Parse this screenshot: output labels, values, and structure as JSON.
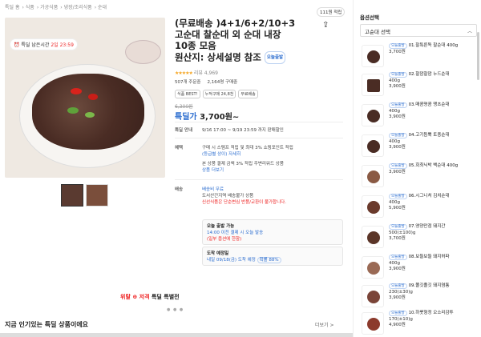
{
  "breadcrumb": [
    "특딜 홈",
    "식품",
    "가공식품",
    "냉장/조리식품",
    "순대"
  ],
  "timer": {
    "label": "특딜 남은시간",
    "value": "2일 23:59"
  },
  "coupon_tag": "111원 적립",
  "title": {
    "line1": "(무료배송 )4+1/6+2/10+3",
    "line2": "고순대 찰순대 외 순대 내장",
    "line3": "10종 모음",
    "line4": "원산지: 상세설명 참조",
    "brand_badge": "오늘출발"
  },
  "rating": {
    "stars": "★★★★★",
    "text": "리뷰 4,969"
  },
  "stats": {
    "likes": "507개 주문중",
    "buyers": "2,164명 구매중",
    "extra": ""
  },
  "tags": [
    "식품 BEST!",
    "누적구매 24,8천",
    "무료배송"
  ],
  "price": {
    "original": "6,300원",
    "label": "특딜가",
    "value": "3,700원~"
  },
  "info": {
    "deal_label": "특딜 안내",
    "deal_value": "9/16 17:00 ~ 9/19 23:59 까지 판매할인",
    "benefit_label": "혜택",
    "benefit_line1": "구매 시 스템프 적립 및 최대 3% 쇼핑포인트 적립",
    "benefit_line2": "(등급별 상이) 자세히",
    "benefit_line3": "본 상품 결제 금액 3% 적립 주변리워드 상품",
    "benefit_line4": "상품 더보기",
    "ship_label": "배송",
    "ship_line1": "배송비 무료",
    "ship_line2": "도서산간지역 배송불가 상품",
    "ship_line3": "신선식품은 단순변심 반품/교환이 불가합니다."
  },
  "ship_box1": {
    "title": "오늘 출발 가능",
    "line1": "14:00 이전 결제 시 오늘 발송",
    "line2": "(일부 옵션에 한함)"
  },
  "ship_box2": {
    "title": "도착 예정일",
    "line1": "내일 09/18(금) 도착 예정",
    "badge": "확률 88%"
  },
  "banner": {
    "left": "위탈",
    "mid": "저격",
    "right": "특딜 특별전"
  },
  "dots": "● ● ●",
  "popular": {
    "title": "지금 인기있는 특딜 상품이에요",
    "more": "더보기 >"
  },
  "side": {
    "title": "옵션선택",
    "select_label": "고순대 선택",
    "options": [
      {
        "badge": "오늘출발",
        "name": "01.찰특른독 찰순대 400g",
        "price": "3,700원"
      },
      {
        "badge": "오늘출발",
        "name": "02.찰깜찰깜 누드순대",
        "sub": "400g",
        "price": "3,900원"
      },
      {
        "badge": "오늘출발",
        "name": "03.매콤명콤 맹초순대",
        "sub": "400g",
        "price": "3,900원"
      },
      {
        "badge": "오늘출발",
        "name": "04.고기듬뿍 토종순대",
        "sub": "400g",
        "price": "3,900원"
      },
      {
        "badge": "오늘출발",
        "name": "05.회최닉박 백순대 400g",
        "sub": "",
        "price": "3,900원"
      },
      {
        "badge": "오늘출발",
        "name": "06.시그니처 김치순대",
        "sub": "400g",
        "price": "5,900원"
      },
      {
        "badge": "오늘출발",
        "name": "07.영양만점 돼지간",
        "sub": "500(±100)g",
        "price": "3,700원"
      },
      {
        "badge": "오늘출발",
        "name": "08.보들보들 돼지허파",
        "sub": "400g",
        "price": "3,900원"
      },
      {
        "badge": "오늘출발",
        "name": "09.쫄깃졸깃 돼지염통",
        "sub": "230(±30)g",
        "price": "3,900원"
      },
      {
        "badge": "오늘출발",
        "name": "10.하룻형정 오소리감투",
        "sub": "170(±10)g",
        "price": "4,900원"
      }
    ]
  }
}
